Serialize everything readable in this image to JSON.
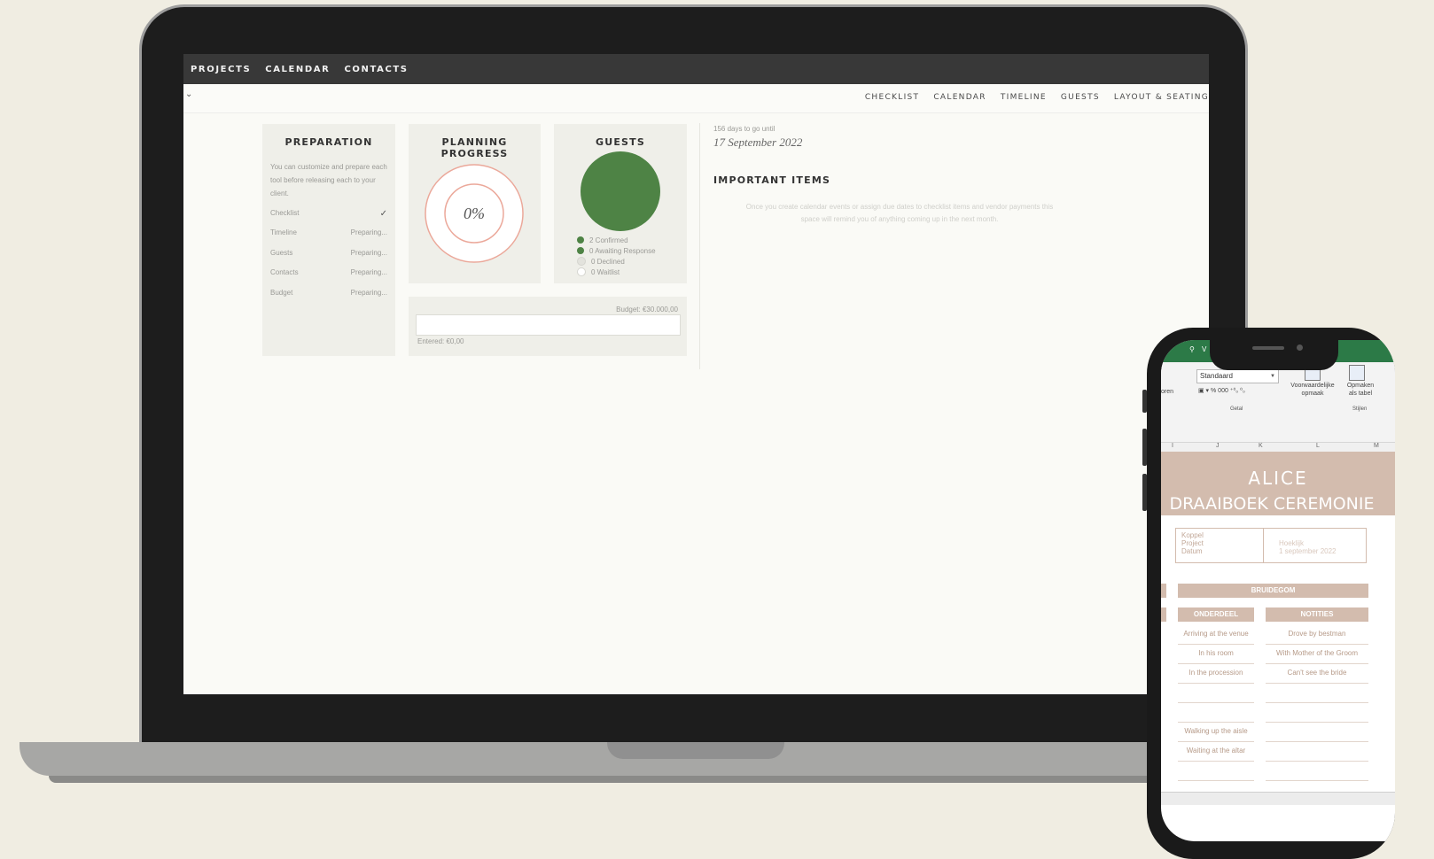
{
  "app": {
    "top_nav": [
      "PROJECTS",
      "CALENDAR",
      "CONTACTS"
    ],
    "sub_nav": [
      "CHECKLIST",
      "CALENDAR",
      "TIMELINE",
      "GUESTS",
      "LAYOUT & SEATING"
    ],
    "preparation": {
      "title": "PREPARATION",
      "description": "You can customize and prepare each tool before releasing each to your client.",
      "rows": [
        {
          "label": "Checklist",
          "status": "✓"
        },
        {
          "label": "Timeline",
          "status": "Preparing..."
        },
        {
          "label": "Guests",
          "status": "Preparing..."
        },
        {
          "label": "Contacts",
          "status": "Preparing..."
        },
        {
          "label": "Budget",
          "status": "Preparing..."
        }
      ]
    },
    "planning_progress": {
      "title": "PLANNING PROGRESS",
      "percent_label": "0%",
      "percent": 0
    },
    "guests": {
      "title": "GUESTS",
      "legend": [
        {
          "label": "2 Confirmed",
          "color": "#4e8345"
        },
        {
          "label": "0 Awaiting Response",
          "color": "#4e8345"
        },
        {
          "label": "0 Declined",
          "color": "#e3e3dd"
        },
        {
          "label": "0 Waitlist",
          "color": "#ffffff"
        }
      ]
    },
    "budget": {
      "budget_label": "Budget: €30.000,00",
      "entered_label": "Entered: €0,00"
    },
    "countdown": "156 days to go until",
    "event_date": "17 September 2022",
    "important_items": {
      "title": "IMPORTANT ITEMS",
      "text": "Once you create calendar events or assign due dates to checklist items and vendor payments this space will remind you of anything coming up in the next month."
    }
  },
  "phone": {
    "ribbon": {
      "number_format": "Standaard",
      "group_number": "Getal",
      "group_styles": "Stijlen",
      "btn_conditional": [
        "Voorwaardelijke",
        "opmaak"
      ],
      "btn_table": [
        "Opmaken",
        "als tabel"
      ],
      "left_label": "oren"
    },
    "columns": [
      "I",
      "J",
      "K",
      "L",
      "M"
    ],
    "header_title": "ALICE",
    "header_subtitle": "DRAAIBOEK CEREMONIE",
    "info_left": [
      "Koppel",
      "Project",
      "Datum"
    ],
    "info_right": [
      "Hoeklijk",
      "1 september 2022"
    ],
    "band_label": "BRUIDEGOM",
    "col_part": "ONDERDEEL",
    "col_notes": "NOTITIES",
    "rows": [
      {
        "part": "Arriving at the venue",
        "note": "Drove by bestman"
      },
      {
        "part": "In his room",
        "note": "With Mother of the Groom"
      },
      {
        "part": "In the procession",
        "note": "Can't see the bride"
      },
      {
        "part": "",
        "note": ""
      },
      {
        "part": "",
        "note": ""
      },
      {
        "part": "Walking up the aisle",
        "note": ""
      },
      {
        "part": "Waiting at the altar",
        "note": ""
      },
      {
        "part": "",
        "note": ""
      }
    ]
  }
}
